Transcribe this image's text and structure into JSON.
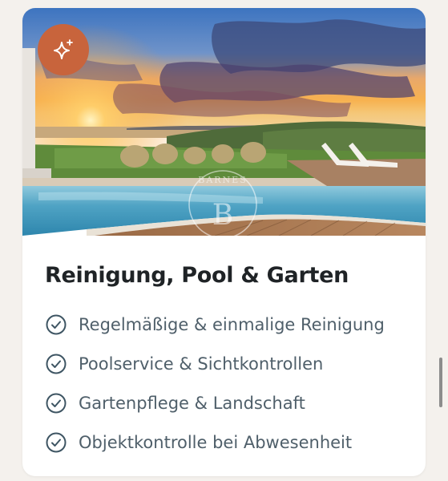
{
  "card": {
    "image_alt": "Infinity pool at sunset overlooking the sea",
    "watermark": "BARNES",
    "title": "Reinigung, Pool & Garten",
    "features": [
      {
        "label": "Regelmäßige & einmalige Reinigung",
        "icon": "check-circle-icon"
      },
      {
        "label": "Poolservice & Sichtkontrollen",
        "icon": "check-circle-icon"
      },
      {
        "label": "Gartenpflege & Landschaft",
        "icon": "check-circle-icon"
      },
      {
        "label": "Objektkontrolle bei Abwesenheit",
        "icon": "check-circle-icon"
      }
    ],
    "badge_icon": "sparkle-icon"
  },
  "colors": {
    "badge": "#c8643c",
    "title": "#1f2326",
    "feature_text": "#4f5f6a",
    "check_icon": "#3e5563",
    "background": "#f4f1ed"
  }
}
